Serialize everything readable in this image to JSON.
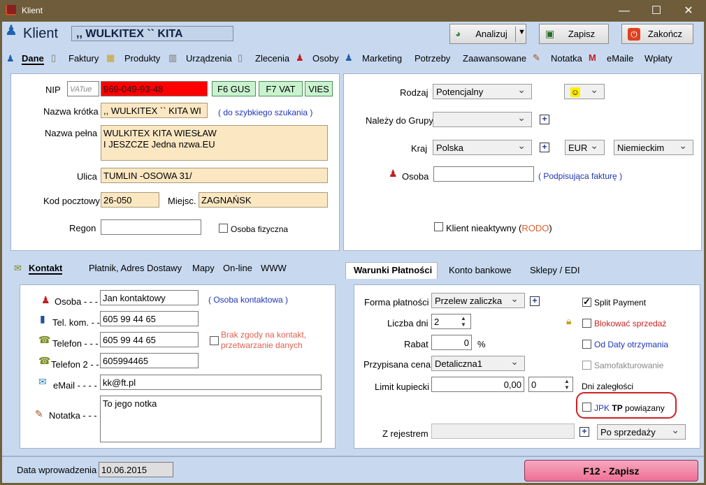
{
  "window": {
    "title": "Klient",
    "min": "—",
    "max": "☐",
    "close": "✕"
  },
  "toolbar": {
    "heading": "Klient",
    "client_field": ",, WULKITEX `` KITA",
    "analyze": "Analizuj",
    "save": "Zapisz",
    "finish": "Zakończ"
  },
  "tabs": [
    "Dane",
    "Faktury",
    "Produkty",
    "Urządzenia",
    "Zlecenia",
    "Osoby",
    "Marketing",
    "Potrzeby",
    "Zaawansowane",
    "Notatka",
    "eMaile",
    "Wpłaty"
  ],
  "left": {
    "nip_label": "NIP",
    "vat_placeholder": "VATue",
    "nip_value": "969-049-93-48",
    "btn_gus": "F6  GUS",
    "btn_vat": "F7 VAT",
    "btn_vies": "VIES",
    "short_label": "Nazwa krótka",
    "short_value": ",, WULKITEX `` KITA WI",
    "short_hint": "( do szybkiego szukania )",
    "full_label": "Nazwa pełna",
    "full_line1": "WULKITEX  KITA WIESŁAW",
    "full_line2": "I JESZCZE Jedna nzwa.EU",
    "street_label": "Ulica",
    "street_value": "TUMLIN -OSOWA 31/",
    "postal_label": "Kod pocztowy",
    "postal_value": "26-050",
    "city_label": "Miejsc.",
    "city_value": "ZAGNAŃSK",
    "regon_label": "Regon",
    "regon_value": "",
    "natural_label": "Osoba fizyczna"
  },
  "right": {
    "type_label": "Rodzaj",
    "type_value": "Potencjalny",
    "mood": "☺",
    "group_label": "Należy do Grupy",
    "group_value": "",
    "country_label": "Kraj",
    "country_value": "Polska",
    "currency": "EUR",
    "language": "Niemieckim",
    "person_label": "Osoba",
    "person_value": "",
    "person_hint": "( Podpisująca fakturę )",
    "inactive_label": "Klient nieaktywny (",
    "rodo": "RODO",
    ")": ")"
  },
  "contact_tabs": [
    "Kontakt",
    "Płatnik, Adres Dostawy",
    "Mapy",
    "On-line",
    "WWW"
  ],
  "contact": {
    "person_label": "Osoba - - -",
    "person_value": "Jan kontaktowy",
    "person_hint": "( Osoba kontaktowa )",
    "mobile_label": "Tel. kom. - -",
    "mobile_value": "605 99 44 65",
    "phone_label": "Telefon - - -",
    "phone_value": "605 99 44 65",
    "consent_label1": "Brak zgody na kontakt,",
    "consent_label2": "przetwarzanie danych",
    "phone2_label": "Telefon 2 - -",
    "phone2_value": "605994465",
    "email_label": "eMail - - - - -",
    "email_value": "kk@ft.pl",
    "note_label": "Notatka - - - -",
    "note_value": "To jego notka"
  },
  "pay_tabs": [
    "Warunki Płatności",
    "Konto bankowe",
    "Sklepy / EDI"
  ],
  "payment": {
    "form_label": "Forma płatności",
    "form_value": "Przelew zaliczka",
    "days_label": "Liczba dni",
    "days_value": "2",
    "discount_label": "Rabat",
    "discount_value": "0",
    "percent": "%",
    "price_label": "Przypisana cena",
    "price_value": "Detaliczna1",
    "limit_label": "Limit kupiecki",
    "limit_value": "0,00",
    "limit_days": "0",
    "split": "Split Payment",
    "block": "Blokować sprzedaż",
    "from_date": "Od Daty otrzymania",
    "selfbill": "Samofakturowanie",
    "overdue": "Dni zaległości",
    "jpk": "JPK",
    "tp": "TP",
    "linked": "powiązany",
    "register_label": "Z rejestrem",
    "register_value": "",
    "after_sale": "Po sprzedaży"
  },
  "footer": {
    "date_label": "Data wprowadzenia",
    "date_value": "10.06.2015",
    "save_btn": "F12 - Zapisz"
  },
  "colors": {
    "nip_bg": "#ff0000",
    "beige": "#fbe7c2",
    "pink_btn": "#f07a9c",
    "highlight": "#d02020"
  }
}
